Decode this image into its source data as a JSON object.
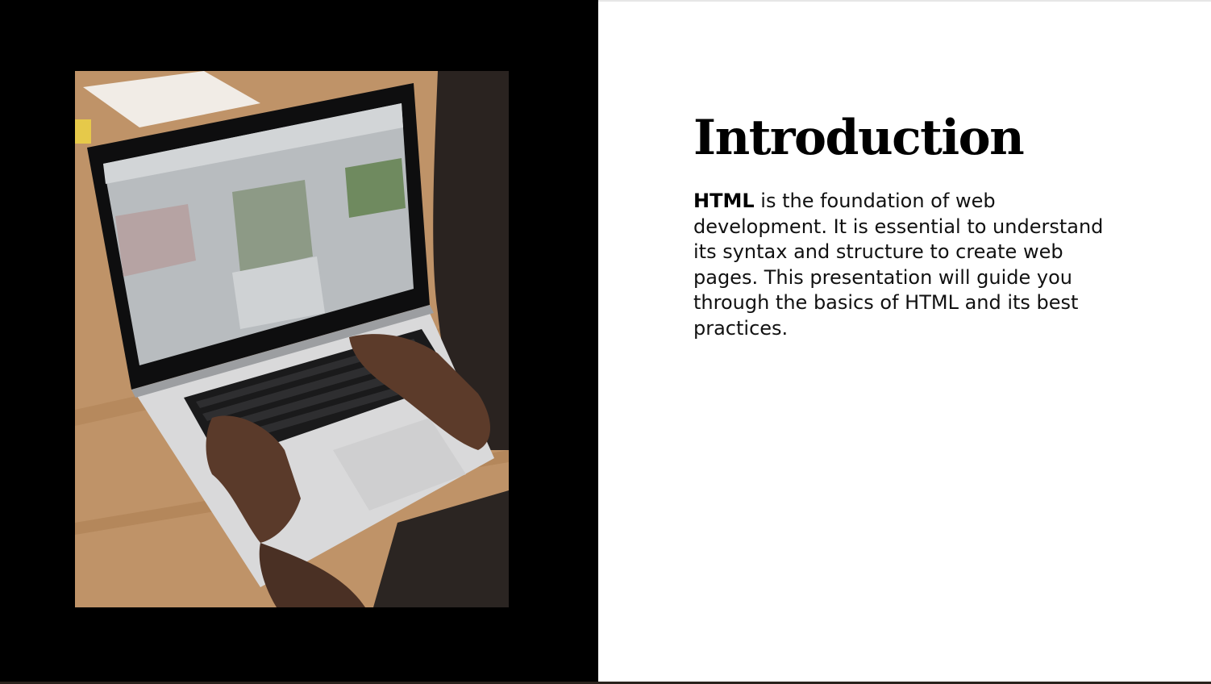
{
  "slide": {
    "title": "Introduction",
    "body_strong": "HTML",
    "body_text": " is the foundation of web development. It is essential to understand its syntax and structure to create web pages. This presentation will guide you through the basics of HTML and its best practices."
  },
  "image": {
    "subject": "hands-typing-on-laptop-photo"
  },
  "colors": {
    "left_panel": "#000000",
    "background": "#ffffff",
    "text": "#000000"
  }
}
